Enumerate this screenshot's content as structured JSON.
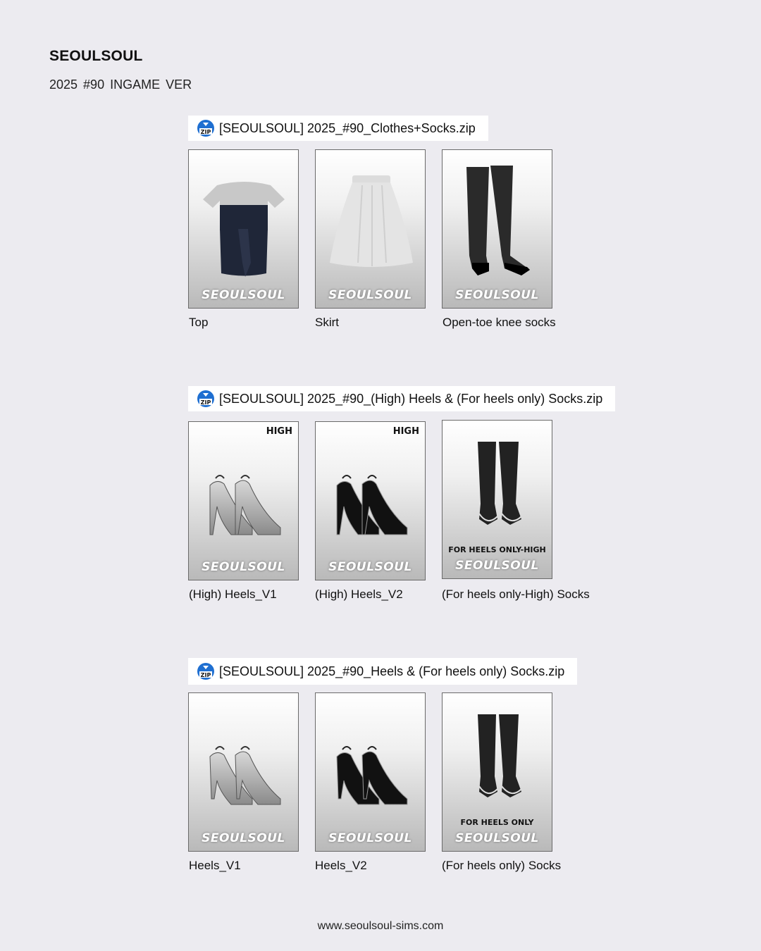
{
  "header": {
    "brand": "SEOULSOUL",
    "subtitle": "2025  #90  INGAME VER"
  },
  "sections": [
    {
      "zip_name": "[SEOULSOUL] 2025_#90_Clothes+Socks.zip",
      "items": [
        {
          "label": "Top",
          "watermark": "SEOULSOUL",
          "icon": "top-icon"
        },
        {
          "label": "Skirt",
          "watermark": "SEOULSOUL",
          "icon": "skirt-icon"
        },
        {
          "label": "Open-toe knee socks",
          "watermark": "SEOULSOUL",
          "icon": "knee-socks-icon"
        }
      ]
    },
    {
      "zip_name": "[SEOULSOUL] 2025_#90_(High) Heels & (For heels only) Socks.zip",
      "items": [
        {
          "label": "(High) Heels_V1",
          "watermark": "SEOULSOUL",
          "tag": "HIGH",
          "icon": "high-heels-silver-icon"
        },
        {
          "label": "(High) Heels_V2",
          "watermark": "SEOULSOUL",
          "tag": "HIGH",
          "icon": "high-heels-black-icon"
        },
        {
          "label": "(For heels only-High) Socks",
          "watermark": "SEOULSOUL",
          "note": "FOR HEELS ONLY-HIGH",
          "icon": "heel-socks-icon"
        }
      ]
    },
    {
      "zip_name": "[SEOULSOUL] 2025_#90_Heels & (For heels only) Socks.zip",
      "items": [
        {
          "label": "Heels_V1",
          "watermark": "SEOULSOUL",
          "icon": "heels-silver-icon"
        },
        {
          "label": "Heels_V2",
          "watermark": "SEOULSOUL",
          "icon": "heels-black-icon"
        },
        {
          "label": "(For heels only) Socks",
          "watermark": "SEOULSOUL",
          "note": "FOR HEELS ONLY",
          "icon": "heel-socks-icon"
        }
      ]
    }
  ],
  "zip_icon_label": "ZIP",
  "footer": {
    "url": "www.seoulsoul-sims.com"
  },
  "colors": {
    "background": "#ecebf0",
    "zip_icon_blue": "#1f6fd1"
  }
}
